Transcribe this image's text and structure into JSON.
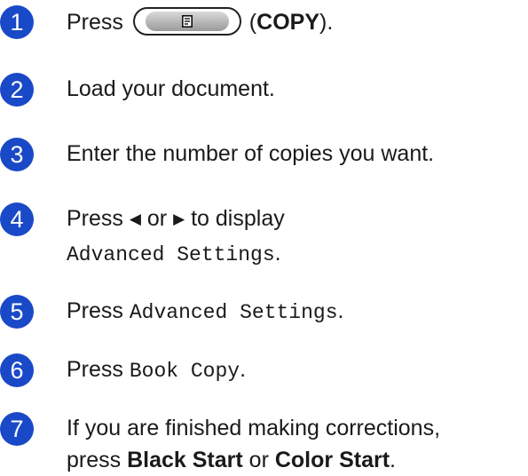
{
  "steps": [
    {
      "number": "1",
      "press": "Press",
      "key_label": "COPY"
    },
    {
      "number": "2",
      "text": "Load your document."
    },
    {
      "number": "3",
      "text": "Enter the number of copies you want."
    },
    {
      "number": "4",
      "press": "Press",
      "or": "or",
      "to_display": "to display",
      "setting": "Advanced Settings",
      "left_icon": "left-triangle-icon",
      "right_icon": "right-triangle-icon"
    },
    {
      "number": "5",
      "press": "Press",
      "setting": "Advanced Settings"
    },
    {
      "number": "6",
      "press": "Press",
      "setting": "Book Copy"
    },
    {
      "number": "7",
      "line1": "If you are finished making corrections,",
      "press": "press",
      "black_start": "Black Start",
      "or": "or",
      "color_start": "Color Start"
    }
  ],
  "icons": {
    "copy_key_icon": "document-icon"
  },
  "colors": {
    "badge": "#1a49c8"
  }
}
